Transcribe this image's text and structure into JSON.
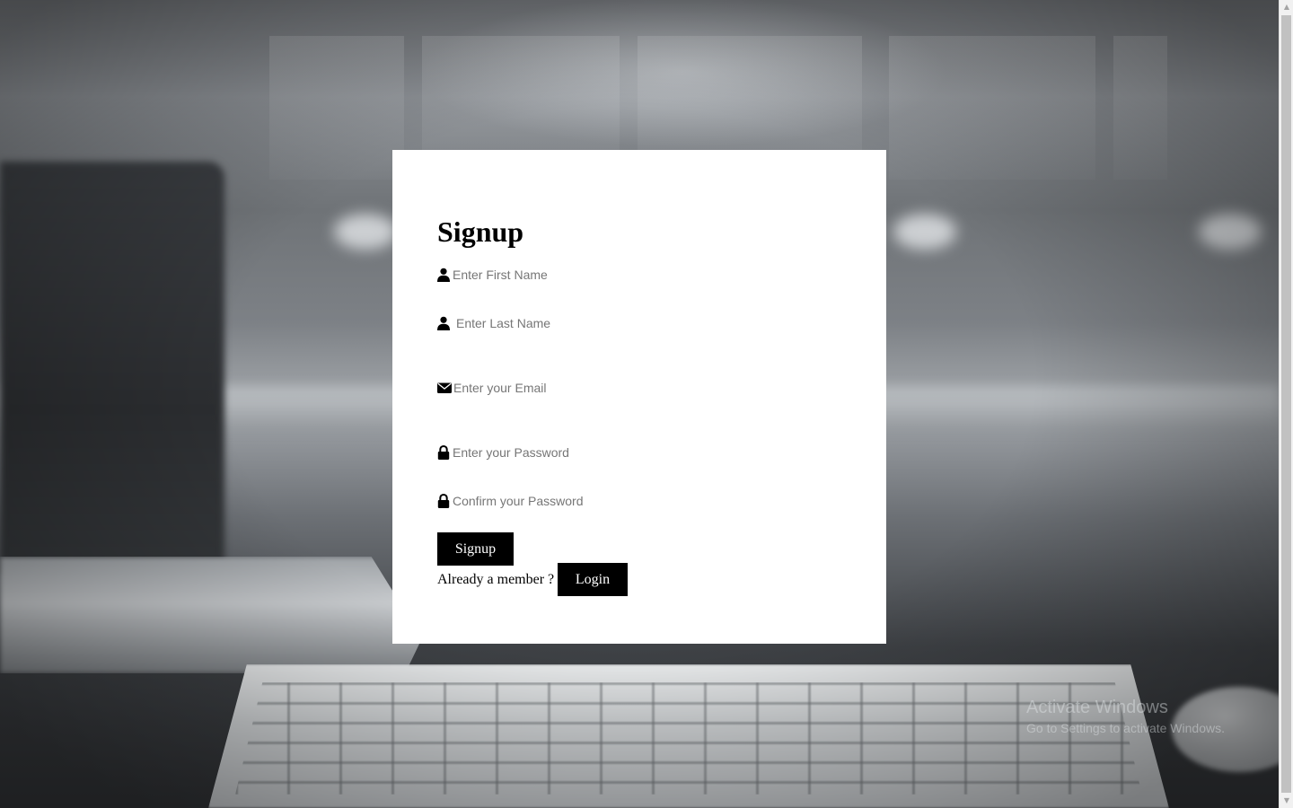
{
  "form": {
    "title": "Signup",
    "fields": {
      "first_name": {
        "placeholder": "Enter First Name",
        "icon": "user-icon"
      },
      "last_name": {
        "placeholder": "Enter Last Name",
        "icon": "user-icon"
      },
      "email": {
        "placeholder": "Enter your Email",
        "icon": "envelope-icon"
      },
      "password": {
        "placeholder": "Enter your Password",
        "icon": "lock-icon"
      },
      "confirm_password": {
        "placeholder": "Confirm your Password",
        "icon": "lock-icon"
      }
    },
    "signup_button": "Signup",
    "already_member_text": "Already a member ?",
    "login_button": "Login"
  },
  "watermark": {
    "title": "Activate Windows",
    "subtitle": "Go to Settings to activate Windows."
  },
  "colors": {
    "card_background": "#ffffff",
    "button_background": "#000000",
    "button_text": "#ffffff"
  }
}
